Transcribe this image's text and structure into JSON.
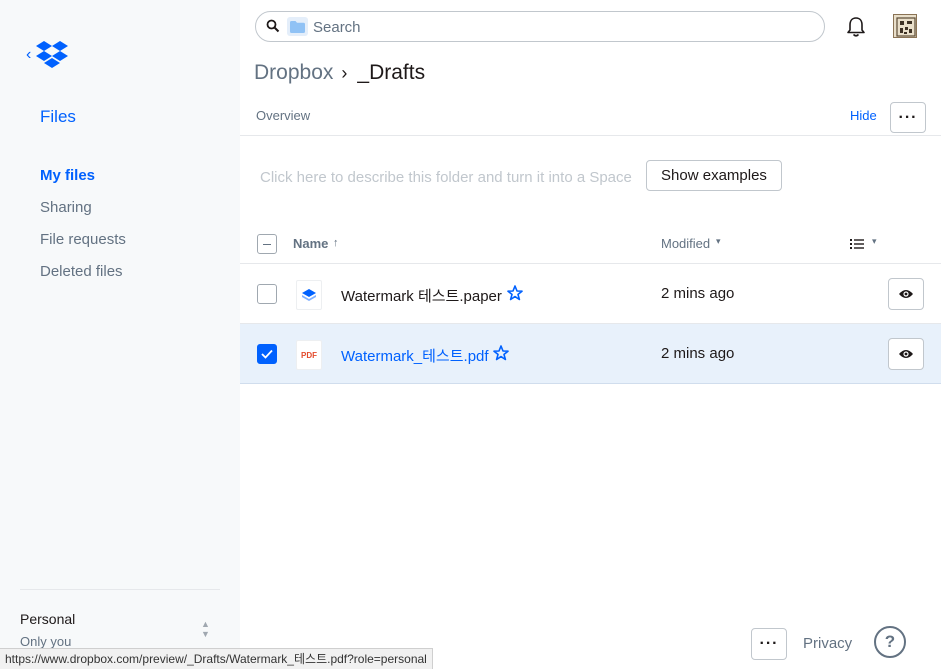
{
  "sidebar": {
    "back_chevron": "‹",
    "logo_icon": "dropbox-logo-icon",
    "files_title": "Files",
    "items": [
      {
        "label": "My files",
        "active": true
      },
      {
        "label": "Sharing",
        "active": false
      },
      {
        "label": "File requests",
        "active": false
      },
      {
        "label": "Deleted files",
        "active": false
      }
    ],
    "account": {
      "name": "Personal",
      "subtitle": "Only you"
    }
  },
  "topbar": {
    "search_placeholder": "Search",
    "search_value": ""
  },
  "breadcrumb": {
    "root": "Dropbox",
    "separator": "›",
    "current": "_Drafts"
  },
  "overview": {
    "label": "Overview",
    "hide_label": "Hide",
    "more_label": "···",
    "description_placeholder": "Click here to describe this folder and turn it into a Space",
    "show_examples_label": "Show examples"
  },
  "table": {
    "headers": {
      "name": "Name",
      "name_sort": "↑",
      "modified": "Modified",
      "caret": "▾"
    },
    "rows": [
      {
        "name": "Watermark 테스트.paper",
        "type": "paper",
        "modified": "2 mins ago",
        "selected": false
      },
      {
        "name": "Watermark_테스트.pdf",
        "type": "pdf",
        "icon_text": "PDF",
        "modified": "2 mins ago",
        "selected": true
      }
    ]
  },
  "footer": {
    "more_label": "···",
    "privacy": "Privacy",
    "help": "?"
  },
  "statusbar": {
    "url": "https://www.dropbox.com/preview/_Drafts/Watermark_테스트.pdf?role=personal"
  },
  "colors": {
    "accent": "#0061fe",
    "muted": "#637282",
    "selected_row": "#e8f1fb",
    "sidebar_bg": "#f7f9fa"
  }
}
